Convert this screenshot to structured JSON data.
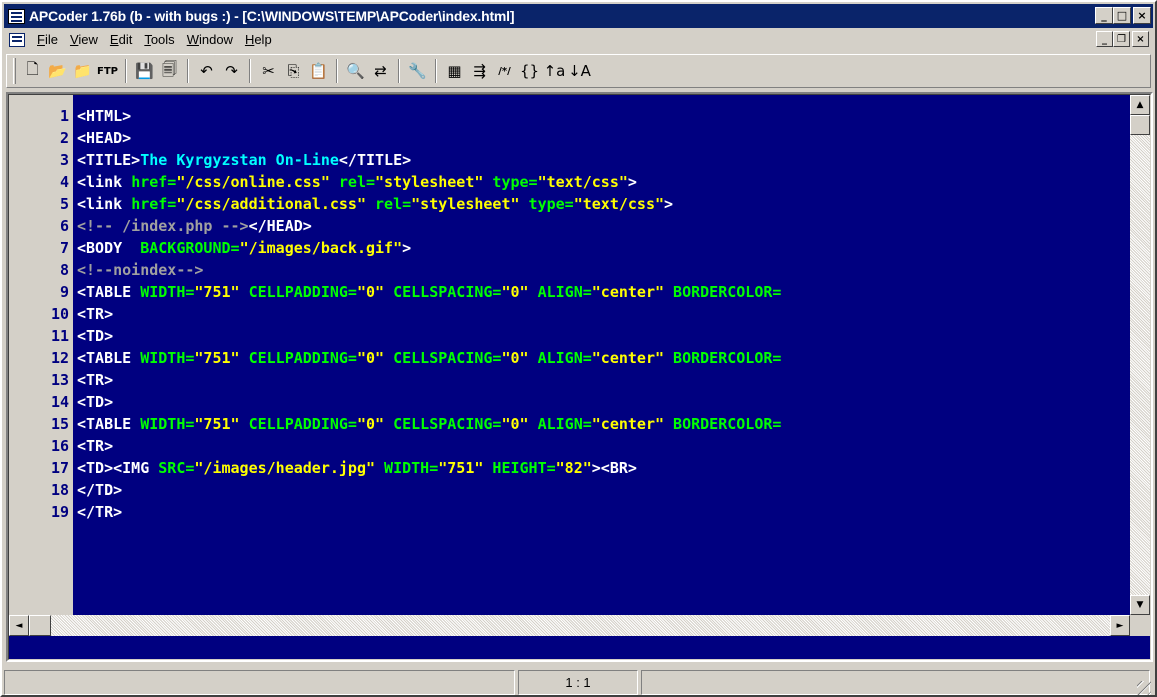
{
  "window": {
    "title": "APCoder 1.76b (b - with bugs :) - [C:\\WINDOWS\\TEMP\\APCoder\\index.html]",
    "caption_buttons": [
      "_",
      "□",
      "×"
    ]
  },
  "menu": {
    "items": [
      {
        "label": "File",
        "accel": "F",
        "rest": "ile"
      },
      {
        "label": "View",
        "accel": "V",
        "rest": "iew"
      },
      {
        "label": "Edit",
        "accel": "E",
        "rest": "dit"
      },
      {
        "label": "Tools",
        "accel": "T",
        "rest": "ools"
      },
      {
        "label": "Window",
        "accel": "W",
        "rest": "indow"
      },
      {
        "label": "Help",
        "accel": "H",
        "rest": "elp"
      }
    ],
    "mdi_buttons": [
      "_",
      "❐",
      "×"
    ]
  },
  "toolbar": {
    "groups": [
      [
        {
          "name": "new-file-icon",
          "glyph": "🗋"
        },
        {
          "name": "open-folder-icon",
          "glyph": "📂"
        },
        {
          "name": "open-remote-icon",
          "glyph": "📁"
        },
        {
          "name": "ftp-icon",
          "glyph": "FTP"
        }
      ],
      [
        {
          "name": "save-icon",
          "glyph": "💾"
        },
        {
          "name": "save-all-icon",
          "glyph": "🗐"
        }
      ],
      [
        {
          "name": "undo-icon",
          "glyph": "↶"
        },
        {
          "name": "redo-icon",
          "glyph": "↷"
        }
      ],
      [
        {
          "name": "cut-icon",
          "glyph": "✂"
        },
        {
          "name": "copy-icon",
          "glyph": "⎘"
        },
        {
          "name": "paste-icon",
          "glyph": "📋"
        }
      ],
      [
        {
          "name": "find-icon",
          "glyph": "🔍"
        },
        {
          "name": "replace-icon",
          "glyph": "⇄"
        }
      ],
      [
        {
          "name": "tools-icon",
          "glyph": "🔧"
        }
      ],
      [
        {
          "name": "color-palette-icon",
          "glyph": "▦"
        },
        {
          "name": "indent-icon",
          "glyph": "⇶"
        },
        {
          "name": "comment-icon",
          "glyph": "/*/"
        },
        {
          "name": "braces-icon",
          "glyph": "{}"
        },
        {
          "name": "uppercase-icon",
          "glyph": "↑a"
        },
        {
          "name": "lowercase-icon",
          "glyph": "↓A"
        }
      ]
    ]
  },
  "editor": {
    "colors": {
      "background": "#000080",
      "tag": "#ffffff",
      "attribute": "#00ff00",
      "string": "#ffff00",
      "title_text": "#00ffff",
      "comment": "#a0a0a0"
    },
    "lines": [
      {
        "num": "1",
        "segments": [
          {
            "t": "<HTML>",
            "c": "tag"
          }
        ]
      },
      {
        "num": "2",
        "segments": [
          {
            "t": "<HEAD>",
            "c": "tag"
          }
        ]
      },
      {
        "num": "3",
        "segments": [
          {
            "t": "<TITLE>",
            "c": "tag"
          },
          {
            "t": "The Kyrgyzstan On-Line",
            "c": "title_text"
          },
          {
            "t": "</TITLE>",
            "c": "tag"
          }
        ]
      },
      {
        "num": "4",
        "segments": [
          {
            "t": "<link ",
            "c": "tag"
          },
          {
            "t": "href=",
            "c": "attribute"
          },
          {
            "t": "\"/css/online.css\"",
            "c": "string"
          },
          {
            "t": " rel=",
            "c": "attribute"
          },
          {
            "t": "\"stylesheet\"",
            "c": "string"
          },
          {
            "t": " type=",
            "c": "attribute"
          },
          {
            "t": "\"text/css\"",
            "c": "string"
          },
          {
            "t": ">",
            "c": "tag"
          }
        ]
      },
      {
        "num": "5",
        "segments": [
          {
            "t": "<link ",
            "c": "tag"
          },
          {
            "t": "href=",
            "c": "attribute"
          },
          {
            "t": "\"/css/additional.css\"",
            "c": "string"
          },
          {
            "t": " rel=",
            "c": "attribute"
          },
          {
            "t": "\"stylesheet\"",
            "c": "string"
          },
          {
            "t": " type=",
            "c": "attribute"
          },
          {
            "t": "\"text/css\"",
            "c": "string"
          },
          {
            "t": ">",
            "c": "tag"
          }
        ]
      },
      {
        "num": "6",
        "segments": [
          {
            "t": "<!-- /index.php -->",
            "c": "comment"
          },
          {
            "t": "</HEAD>",
            "c": "tag"
          }
        ]
      },
      {
        "num": "7",
        "segments": [
          {
            "t": "<BODY  ",
            "c": "tag"
          },
          {
            "t": "BACKGROUND=",
            "c": "attribute"
          },
          {
            "t": "\"/images/back.gif\"",
            "c": "string"
          },
          {
            "t": ">",
            "c": "tag"
          }
        ]
      },
      {
        "num": "8",
        "segments": [
          {
            "t": "<!--noindex-->",
            "c": "comment"
          }
        ]
      },
      {
        "num": "9",
        "segments": [
          {
            "t": "<TABLE ",
            "c": "tag"
          },
          {
            "t": "WIDTH=",
            "c": "attribute"
          },
          {
            "t": "\"751\"",
            "c": "string"
          },
          {
            "t": " CELLPADDING=",
            "c": "attribute"
          },
          {
            "t": "\"0\"",
            "c": "string"
          },
          {
            "t": " CELLSPACING=",
            "c": "attribute"
          },
          {
            "t": "\"0\"",
            "c": "string"
          },
          {
            "t": " ALIGN=",
            "c": "attribute"
          },
          {
            "t": "\"center\"",
            "c": "string"
          },
          {
            "t": " BORDERCOLOR=",
            "c": "attribute"
          }
        ]
      },
      {
        "num": "10",
        "segments": [
          {
            "t": "<TR>",
            "c": "tag"
          }
        ]
      },
      {
        "num": "11",
        "segments": [
          {
            "t": "<TD>",
            "c": "tag"
          }
        ]
      },
      {
        "num": "12",
        "segments": [
          {
            "t": "<TABLE ",
            "c": "tag"
          },
          {
            "t": "WIDTH=",
            "c": "attribute"
          },
          {
            "t": "\"751\"",
            "c": "string"
          },
          {
            "t": " CELLPADDING=",
            "c": "attribute"
          },
          {
            "t": "\"0\"",
            "c": "string"
          },
          {
            "t": " CELLSPACING=",
            "c": "attribute"
          },
          {
            "t": "\"0\"",
            "c": "string"
          },
          {
            "t": " ALIGN=",
            "c": "attribute"
          },
          {
            "t": "\"center\"",
            "c": "string"
          },
          {
            "t": " BORDERCOLOR=",
            "c": "attribute"
          }
        ]
      },
      {
        "num": "13",
        "segments": [
          {
            "t": "<TR>",
            "c": "tag"
          }
        ]
      },
      {
        "num": "14",
        "segments": [
          {
            "t": "<TD>",
            "c": "tag"
          }
        ]
      },
      {
        "num": "15",
        "segments": [
          {
            "t": "<TABLE ",
            "c": "tag"
          },
          {
            "t": "WIDTH=",
            "c": "attribute"
          },
          {
            "t": "\"751\"",
            "c": "string"
          },
          {
            "t": " CELLPADDING=",
            "c": "attribute"
          },
          {
            "t": "\"0\"",
            "c": "string"
          },
          {
            "t": " CELLSPACING=",
            "c": "attribute"
          },
          {
            "t": "\"0\"",
            "c": "string"
          },
          {
            "t": " ALIGN=",
            "c": "attribute"
          },
          {
            "t": "\"center\"",
            "c": "string"
          },
          {
            "t": " BORDERCOLOR=",
            "c": "attribute"
          }
        ]
      },
      {
        "num": "16",
        "segments": [
          {
            "t": "<TR>",
            "c": "tag"
          }
        ]
      },
      {
        "num": "17",
        "segments": [
          {
            "t": "<TD><IMG ",
            "c": "tag"
          },
          {
            "t": "SRC=",
            "c": "attribute"
          },
          {
            "t": "\"/images/header.jpg\"",
            "c": "string"
          },
          {
            "t": " WIDTH=",
            "c": "attribute"
          },
          {
            "t": "\"751\"",
            "c": "string"
          },
          {
            "t": " HEIGHT=",
            "c": "attribute"
          },
          {
            "t": "\"82\"",
            "c": "string"
          },
          {
            "t": "><BR>",
            "c": "tag"
          }
        ]
      },
      {
        "num": "18",
        "segments": [
          {
            "t": "</TD>",
            "c": "tag"
          }
        ]
      },
      {
        "num": "19",
        "segments": [
          {
            "t": "</TR>",
            "c": "tag"
          }
        ]
      }
    ]
  },
  "scrollbars": {
    "up_arrow": "▲",
    "down_arrow": "▼",
    "left_arrow": "◄",
    "right_arrow": "►"
  },
  "statusbar": {
    "panels": [
      "",
      "1 : 1",
      ""
    ]
  }
}
